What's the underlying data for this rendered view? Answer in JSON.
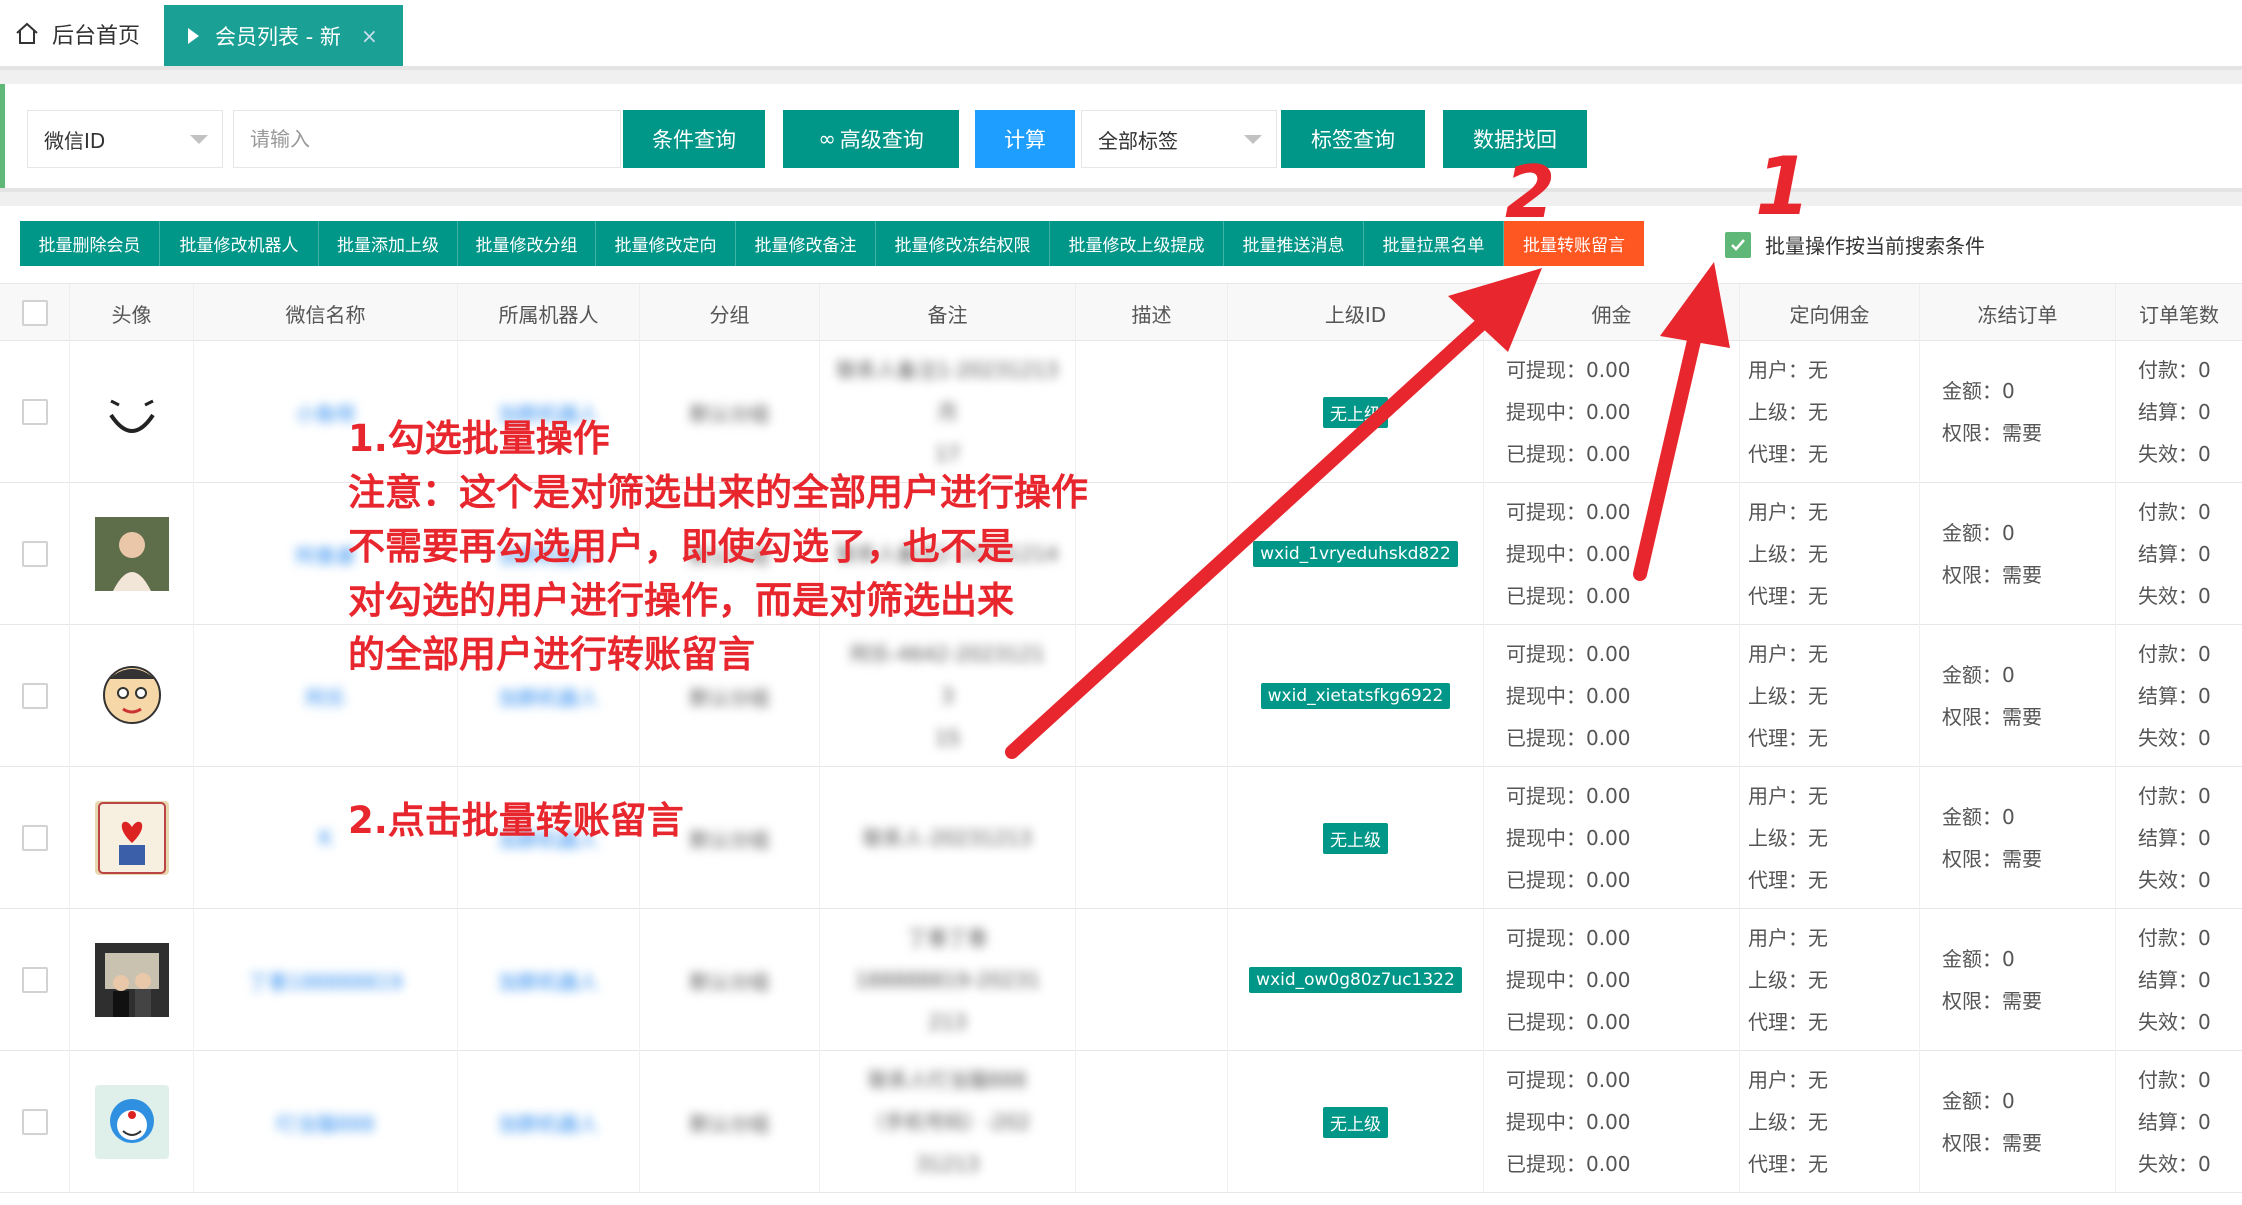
{
  "tabs": {
    "home_label": "后台首页",
    "active_label": "会员列表 - 新",
    "close_glyph": "×"
  },
  "search": {
    "field_select": "微信ID",
    "input_placeholder": "请输入",
    "condition_query": "条件查询",
    "advanced_query": "高级查询",
    "calculate": "计算",
    "tag_select": "全部标签",
    "tag_query": "标签查询",
    "data_recover": "数据找回"
  },
  "batch": {
    "buttons": [
      "批量删除会员",
      "批量修改机器人",
      "批量添加上级",
      "批量修改分组",
      "批量修改定向",
      "批量修改备注",
      "批量修改冻结权限",
      "批量修改上级提成",
      "批量推送消息",
      "批量拉黑名单",
      "批量转账留言"
    ],
    "checkbox_label": "批量操作按当前搜索条件",
    "checkbox_checked": true
  },
  "table": {
    "headers": [
      "头像",
      "微信名称",
      "所属机器人",
      "分组",
      "备注",
      "描述",
      "上级ID",
      "佣金",
      "定向佣金",
      "冻结订单",
      "订单笔数"
    ],
    "rows": [
      {
        "wechat_name": "小鱼呀",
        "robot": "加群机器人",
        "group": "默认分组",
        "remark": [
          "联系人备注1-20231213",
          "月",
          "17"
        ],
        "parent_id": "无上级",
        "commission": [
          "可提现：0.00",
          "提现中：0.00",
          "已提现：0.00"
        ],
        "directed": [
          "用户：无",
          "上级：无",
          "代理：无"
        ],
        "frozen": [
          "金额：0",
          "权限：需要"
        ],
        "orders": [
          "付款：0",
          "结算：0",
          "失效：0"
        ]
      },
      {
        "wechat_name": "阿香婆",
        "robot": "加群机器人",
        "group": "默认分组",
        "remark": [
          "联系人备注2-20231214"
        ],
        "parent_id": "wxid_1vryeduhskd822",
        "commission": [
          "可提现：0.00",
          "提现中：0.00",
          "已提现：0.00"
        ],
        "directed": [
          "用户：无",
          "上级：无",
          "代理：无"
        ],
        "frozen": [
          "金额：0",
          "权限：需要"
        ],
        "orders": [
          "付款：0",
          "结算：0",
          "失效：0"
        ]
      },
      {
        "wechat_name": "阿乐",
        "robot": "加群机器人",
        "group": "默认分组",
        "remark": [
          "阿乐-4642-2023121",
          "3",
          "15"
        ],
        "parent_id": "wxid_xietatsfkg6922",
        "commission": [
          "可提现：0.00",
          "提现中：0.00",
          "已提现：0.00"
        ],
        "directed": [
          "用户：无",
          "上级：无",
          "代理：无"
        ],
        "frozen": [
          "金额：0",
          "权限：需要"
        ],
        "orders": [
          "付款：0",
          "结算：0",
          "失效：0"
        ]
      },
      {
        "wechat_name": "K",
        "robot": "加群机器人",
        "group": "默认分组",
        "remark": [
          "联系人-20231213"
        ],
        "parent_id": "无上级",
        "commission": [
          "可提现：0.00",
          "提现中：0.00",
          "已提现：0.00"
        ],
        "directed": [
          "用户：无",
          "上级：无",
          "代理：无"
        ],
        "frozen": [
          "金额：0",
          "权限：需要"
        ],
        "orders": [
          "付款：0",
          "结算：0",
          "失效：0"
        ]
      },
      {
        "wechat_name": "丁香188888819",
        "robot": "加群机器人",
        "group": "默认分组",
        "remark": [
          "丁香丁香",
          "188888819-20231",
          "213"
        ],
        "parent_id": "wxid_ow0g80z7uc1322",
        "commission": [
          "可提现：0.00",
          "提现中：0.00",
          "已提现：0.00"
        ],
        "directed": [
          "用户：无",
          "上级：无",
          "代理：无"
        ],
        "frozen": [
          "金额：0",
          "权限：需要"
        ],
        "orders": [
          "付款：0",
          "结算：0",
          "失效：0"
        ]
      },
      {
        "wechat_name": "叮当猫888",
        "robot": "加群机器人",
        "group": "默认分组",
        "remark": [
          "联系人叮当猫888",
          "（手机号码）-202",
          "31213"
        ],
        "parent_id": "无上级",
        "commission": [
          "可提现：0.00",
          "提现中：0.00",
          "已提现：0.00"
        ],
        "directed": [
          "用户：无",
          "上级：无",
          "代理：无"
        ],
        "frozen": [
          "金额：0",
          "权限：需要"
        ],
        "orders": [
          "付款：0",
          "结算：0",
          "失效：0"
        ]
      }
    ]
  },
  "annotations": {
    "step1_title": "1.勾选批量操作",
    "step1_notes": [
      "注意：这个是对筛选出来的全部用户进行操作",
      "不需要再勾选用户，即使勾选了，也不是",
      "对勾选的用户进行操作，而是对筛选出来",
      "的全部用户进行转账留言"
    ],
    "step2": "2.点击批量转账留言",
    "num1": "1",
    "num2": "2",
    "color": "#e8262d"
  }
}
